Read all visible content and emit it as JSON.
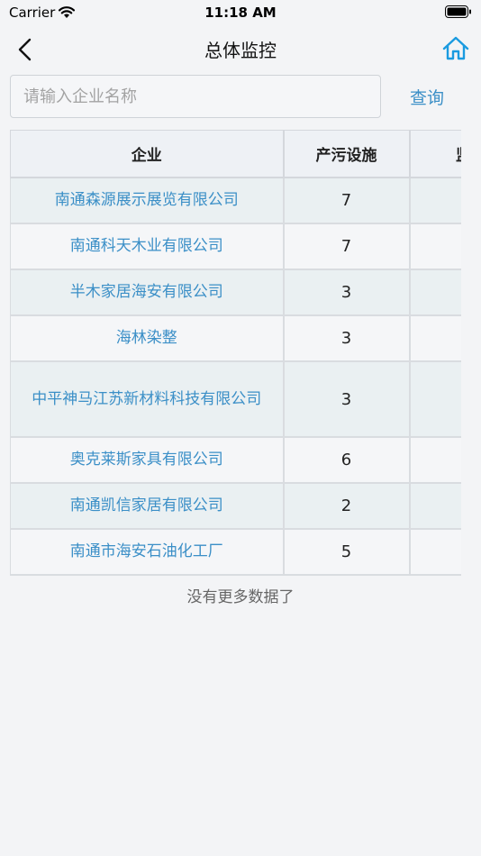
{
  "status_bar": {
    "carrier": "Carrier",
    "time": "11:18 AM"
  },
  "nav": {
    "title": "总体监控",
    "back_icon": "chevron-left-icon",
    "home_icon": "home-icon"
  },
  "search": {
    "placeholder": "请输入企业名称",
    "value": "",
    "button_label": "查询"
  },
  "table": {
    "headers": [
      "企业",
      "产污设施",
      "监测"
    ],
    "rows": [
      {
        "company": "南通森源展示展览有限公司",
        "facilities": "7",
        "monitor": ""
      },
      {
        "company": "南通科天木业有限公司",
        "facilities": "7",
        "monitor": ""
      },
      {
        "company": "半木家居海安有限公司",
        "facilities": "3",
        "monitor": ""
      },
      {
        "company": "海林染整",
        "facilities": "3",
        "monitor": ""
      },
      {
        "company": "中平神马江苏新材料科技有限公司",
        "facilities": "3",
        "monitor": ""
      },
      {
        "company": "奥克莱斯家具有限公司",
        "facilities": "6",
        "monitor": ""
      },
      {
        "company": "南通凯信家居有限公司",
        "facilities": "2",
        "monitor": ""
      },
      {
        "company": "南通市海安石油化工厂",
        "facilities": "5",
        "monitor": ""
      }
    ]
  },
  "footer": {
    "no_more": "没有更多数据了"
  },
  "colors": {
    "accent": "#3b8fc7",
    "row_alt": "#eaf0f2",
    "background": "#f3f4f6"
  }
}
